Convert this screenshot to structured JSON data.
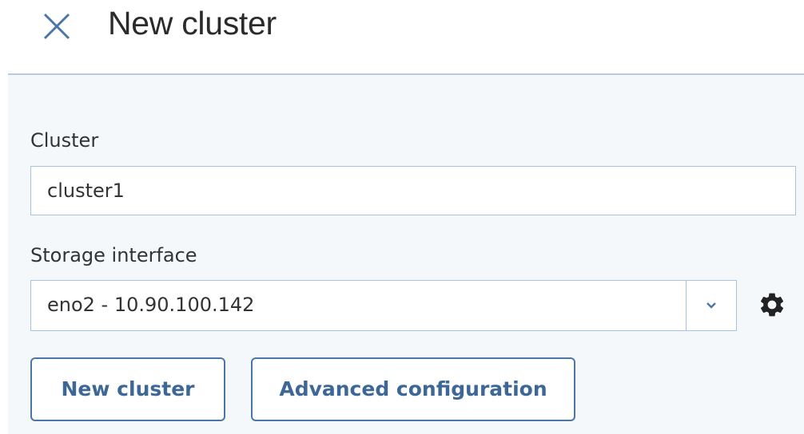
{
  "header": {
    "title": "New cluster",
    "close_icon": "close-icon"
  },
  "form": {
    "cluster_label": "Cluster",
    "cluster_value": "cluster1",
    "storage_label": "Storage interface",
    "storage_value": "eno2 - 10.90.100.142",
    "dropdown_icon": "chevron-down-icon",
    "settings_icon": "gear-icon"
  },
  "actions": {
    "new_cluster_label": "New cluster",
    "advanced_label": "Advanced configuration"
  },
  "colors": {
    "accent": "#3d6797",
    "border": "#a9c4e0",
    "panel_bg": "#f5f8fb"
  }
}
